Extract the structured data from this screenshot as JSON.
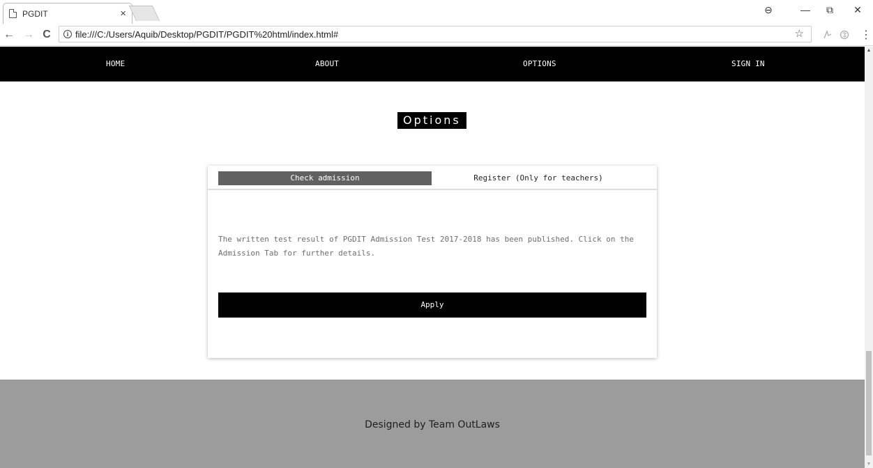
{
  "browser": {
    "tab_title": "PGDIT",
    "tab_close": "×",
    "url": "file:///C:/Users/Aquib/Desktop/PGDIT/PGDIT%20html/index.html#",
    "icons": {
      "back": "←",
      "forward": "→",
      "reload": "C",
      "info": "i",
      "star": "☆",
      "account": "⊖",
      "minimize": "—",
      "restore": "⧉",
      "close": "✕",
      "menu": "⋮"
    }
  },
  "nav": {
    "items": [
      {
        "label": "HOME"
      },
      {
        "label": "ABOUT"
      },
      {
        "label": "OPTIONS"
      },
      {
        "label": "SIGN IN"
      }
    ]
  },
  "main": {
    "heading": "Options",
    "tabs": [
      {
        "label": "Check admission",
        "active": true
      },
      {
        "label": "Register (Only for teachers)",
        "active": false
      }
    ],
    "notice": "The written test result of PGDIT Admission Test 2017-2018 has been published. Click on the Admission Tab for further details.",
    "apply_label": "Apply"
  },
  "footer": {
    "text": "Designed by Team OutLaws"
  },
  "colors": {
    "nav_bg": "#000000",
    "tab_active_bg": "#616161",
    "footer_bg": "#9c9c9c"
  }
}
